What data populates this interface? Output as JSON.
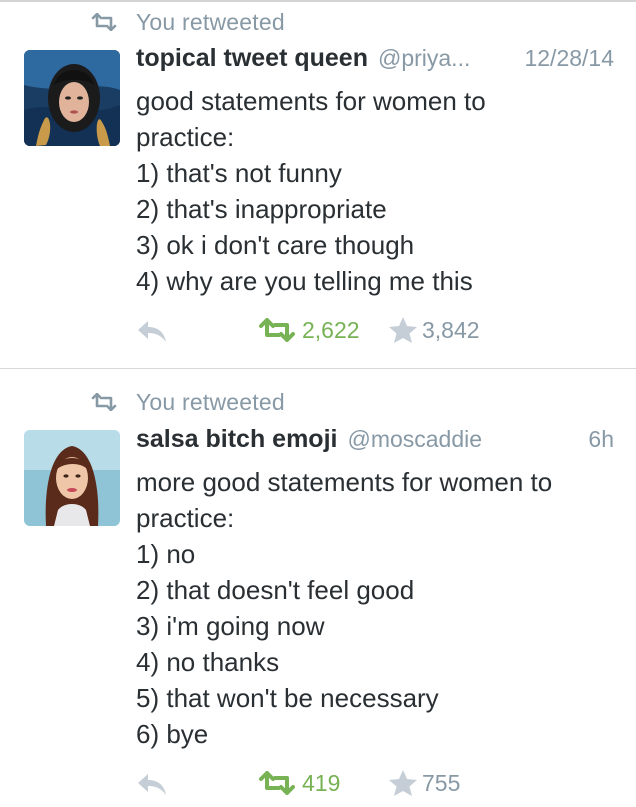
{
  "tweets": [
    {
      "retweet_label": "You retweeted",
      "display_name": "topical tweet queen",
      "handle": "@priya...",
      "time": "12/28/14",
      "lines": [
        "good statements for women to",
        "practice:",
        "1) that's not funny",
        "2) that's inappropriate",
        "3) ok i don't care though",
        "4) why are you telling me this"
      ],
      "retweet_count": "2,622",
      "favorite_count": "3,842"
    },
    {
      "retweet_label": "You retweeted",
      "display_name": "salsa bitch emoji",
      "handle": "@moscaddie",
      "time": "6h",
      "lines": [
        "more good statements for women to",
        "practice:",
        "1) no",
        "2) that doesn't feel good",
        "3) i'm going now",
        "4) no thanks",
        "5) that won't be necessary",
        "6) bye"
      ],
      "retweet_count": "419",
      "favorite_count": "755"
    }
  ],
  "colors": {
    "retweet_active": "#77b255",
    "muted": "#8899a6",
    "text": "#292f33"
  },
  "icons": {
    "retweet": "retweet-icon",
    "reply": "reply-icon",
    "favorite": "star-icon"
  }
}
